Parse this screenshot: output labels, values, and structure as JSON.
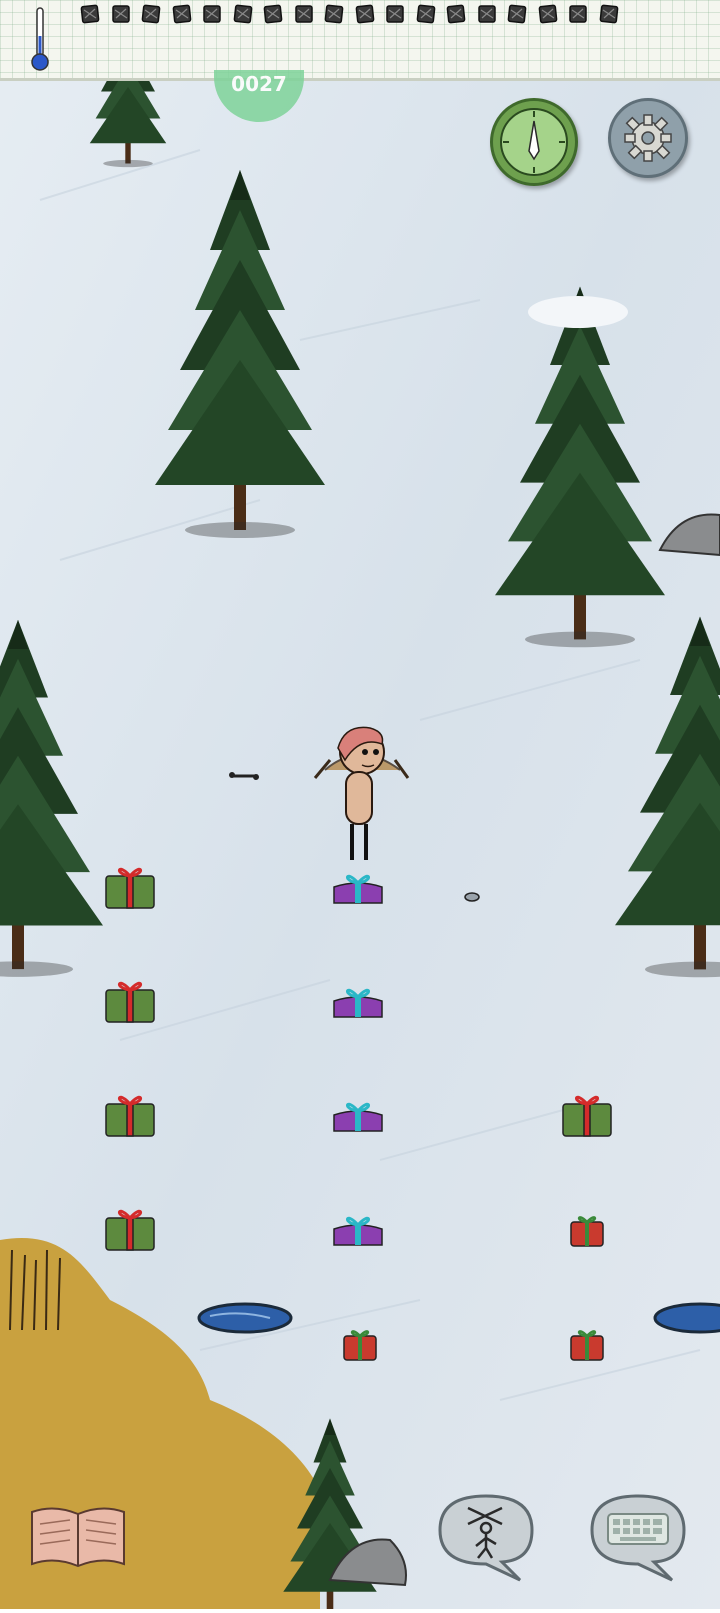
{
  "hud": {
    "thermometer_icon": "thermometer-icon",
    "food_pips": 18,
    "compass_icon": "compass-icon",
    "settings_icon": "gear-icon",
    "status_badge_text": "0027"
  },
  "toolbar": {
    "journal_icon": "open-book-icon",
    "puppet_icon": "puppet-marionette-icon",
    "keyboard_icon": "keyboard-icon"
  },
  "colors": {
    "snow": "#dfe7ef",
    "grass": "#c9a13f",
    "pine_dark": "#1e3a22",
    "pine_mid": "#2f5a33",
    "gift_green": "#5d8a3e",
    "gift_purple": "#8b3fb0",
    "gift_red": "#c93a2e",
    "ribbon": "#d22a2a",
    "ice": "#2d5fa8"
  },
  "world_items": {
    "character": "naked-player-character",
    "gifts_green": 5,
    "gifts_purple": 4,
    "gifts_red": 4,
    "ponds": 2,
    "trees": 6,
    "boulders": 2
  }
}
